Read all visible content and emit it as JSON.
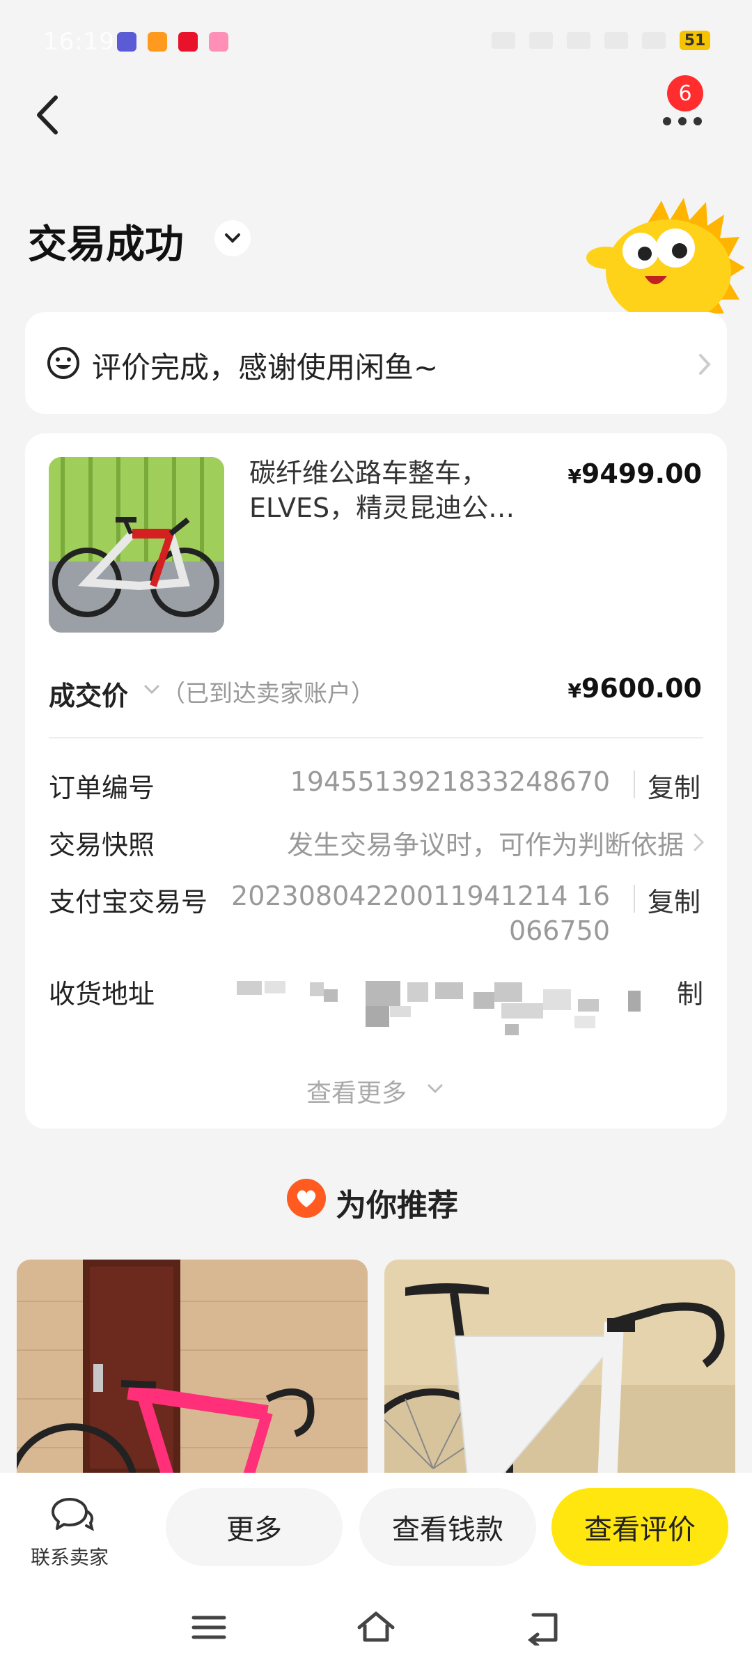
{
  "status_bar": {
    "time": "16:19",
    "battery": "51"
  },
  "nav": {
    "badge_count": "6"
  },
  "title": "交易成功",
  "review_banner": {
    "text": "评价完成，感谢使用闲鱼~"
  },
  "product": {
    "title": "碳纤维公路车整车，ELVES，精灵昆迪公…",
    "price_symbol": "¥",
    "price": "9499.00"
  },
  "deal": {
    "label": "成交价",
    "note": "（已到达卖家账户）",
    "price_symbol": "¥",
    "price": "9600.00"
  },
  "rows": {
    "order_no": {
      "label": "订单编号",
      "value": "1945513921833248670",
      "action": "复制"
    },
    "snapshot": {
      "label": "交易快照",
      "value": "发生交易争议时，可作为判断依据"
    },
    "alipay": {
      "label": "支付宝交易号",
      "value_line1": "20230804220011941214 16",
      "value_line2": "066750",
      "action": "复制"
    },
    "address": {
      "label": "收货地址",
      "action": "制"
    }
  },
  "view_more": "查看更多",
  "recommend": {
    "title": "为你推荐"
  },
  "bottom_bar": {
    "contact_label": "联系卖家",
    "more_label": "更多",
    "money_label": "查看钱款",
    "review_label": "查看评价"
  },
  "colors": {
    "accent_yellow": "#ffe60f",
    "badge_red": "#ff2d2d",
    "heart_orange": "#ff5a1f"
  }
}
